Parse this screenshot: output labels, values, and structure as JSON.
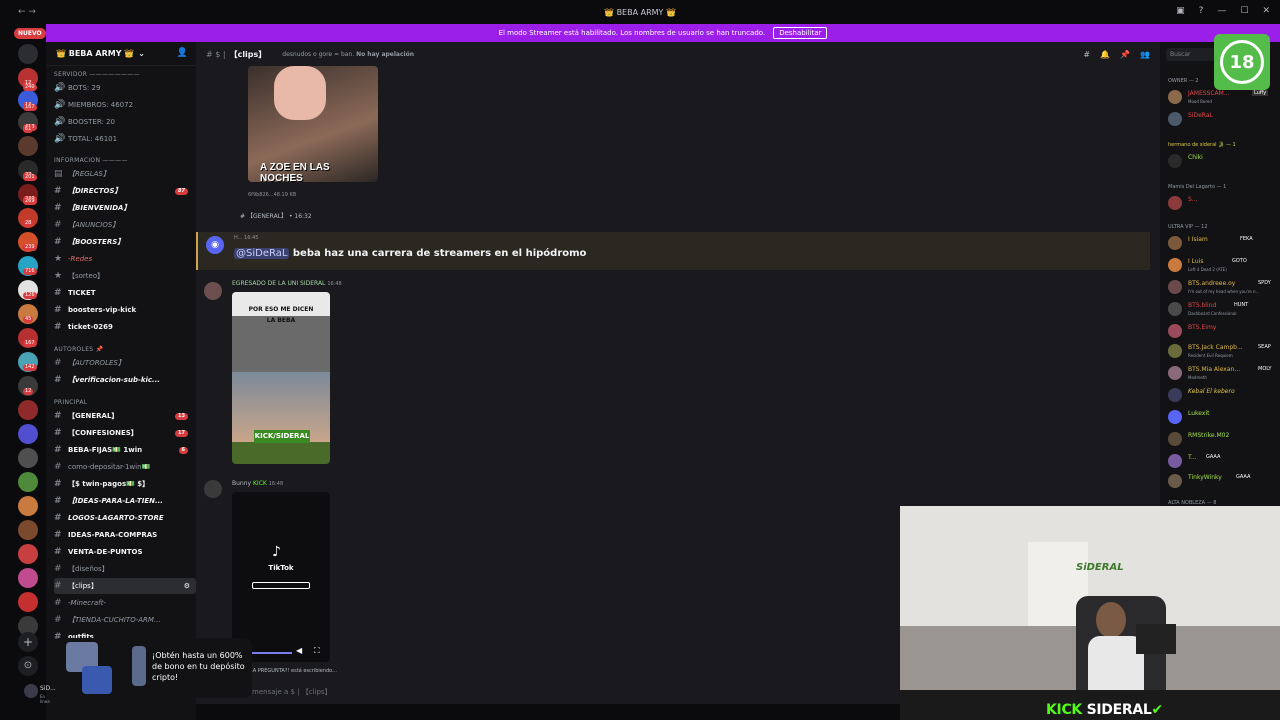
{
  "window": {
    "title": "👑 BEBA ARMY 👑"
  },
  "banner": {
    "text": "El modo Streamer está habilitado. Los nombres de usuario se han truncado.",
    "button": "Deshabilitar"
  },
  "rail": {
    "new_label": "NUEVO",
    "counts": [
      "12",
      "14",
      "413",
      "27",
      "240",
      "167",
      "61",
      "201",
      "269",
      "28",
      "239",
      "716",
      "126",
      "45",
      "167",
      "142",
      "12"
    ]
  },
  "server": {
    "name": "👑 BEBA ARMY 👑"
  },
  "channels": {
    "cat_servidor": "SERVIDOR ————————",
    "bots": "BOTS: 29",
    "miembros": "MIEMBROS: 46072",
    "booster": "BOOSTER: 20",
    "total": "TOTAL: 46101",
    "cat_informacion": "INFORMACION ————",
    "reglas": "【REGLAS】",
    "directos": "【DIRECTOS】",
    "directos_badge": "87",
    "bienvenida": "【BIENVENIDA】",
    "anuncios": "【ANUNCIOS】",
    "boosters": "【BOOSTERS】",
    "redes": "-Redes",
    "sorteo": "【sorteo】",
    "ticket": "TICKET",
    "boosters_vip": "boosters-vip-kick",
    "ticket_0269": "ticket-0269",
    "cat_autoroles": "AUTOROLES 📌",
    "autoroles": "【AUTOROLES】",
    "verificacion": "【verificacion-sub-kic...",
    "cat_principal": "PRINCIPAL",
    "general": "【GENERAL】",
    "general_badge": "13",
    "confesiones": "【CONFESIONES】",
    "confesiones_badge": "17",
    "beba_fijas": "BEBA-FIJAS💵 1win",
    "beba_fijas_badge": "6",
    "como_depositar": "como-depositar-1win💵",
    "twin_pagos": "【$ twin-pagos💵 $】",
    "ideas_tienda": "【IDEAS-PARA-LA-TIEN...",
    "logos": "LOGOS-LAGARTO-STORE",
    "ideas_compras": "IDEAS-PARA-COMPRAS",
    "venta_puntos": "VENTA-DE-PUNTOS",
    "disenos": "【diseños】",
    "clips": "【clips】",
    "minecraft": "-Minecraft-",
    "tienda": "【TIENDA-CUCHITO-ARM...",
    "outfits": "outfits"
  },
  "header": {
    "channel": "【clips】",
    "topic_prefix": "desnudos o gore = ban. ",
    "topic_bold": "No hay apelación"
  },
  "messages": {
    "img1_caption": "A ZOE EN LAS NOCHES",
    "img1_meta": "6f9b826...48.19 KB",
    "reply_ref": "【GENERAL】 • 16:32",
    "m1_author": "H...",
    "m1_time": "16:45",
    "m1_mention": "@SiDeRaL",
    "m1_text": " beba haz una carrera de streamers en el hipódromo",
    "m2_author": "EGRESADO DE LA UNI SIDERAL",
    "m2_time": "16:48",
    "m2_top": "POR ESO ME DICEN",
    "m2_mid": "LA BEBA",
    "m2_kick": "KICK/SIDERAL",
    "m3_author": "Bunny",
    "m3_tag": "KICK",
    "m3_time": "16:48",
    "tiktok": "TikTok"
  },
  "typing": {
    "text": "...A PREGUNTA?! está escribiendo..."
  },
  "input": {
    "placeholder": "mensaje a $ | 【clips】"
  },
  "members": {
    "search": "Buscar",
    "owner_group": "OWNER — 2",
    "owner1_name": "JAMESSCAM...",
    "owner1_status": "Mood Bored",
    "owner1_tag": "Luffy",
    "owner2_name": "SiDeRaL",
    "hermano_group": "hermano de sideral 🐊 — 1",
    "hermano_name": "Chiki",
    "mamis_group": "Mamis Del Lagarto — 1",
    "mamis_name": "S...",
    "ultra_group": "ULTRA VIP — 12",
    "u1_name": "I Isiam",
    "u1_tag": "FEKA",
    "u2_name": "I Luis",
    "u2_tag": "GOTO",
    "u2_status": "Left 4 Dead 2 (ATE)",
    "u3_name": "BTS.andreee.oy",
    "u3_tag": "SPDY",
    "u3_status": "I'm out of my head when you're n...",
    "u4_name": "BTS.blind",
    "u4_tag": "HUNT",
    "u4_status": "Dashboard Confessional",
    "u5_name": "BTS.Eimy",
    "u6_name": "BTS.Jack Campb...",
    "u6_tag": "SEAP",
    "u6_status": "Resident Evil Requiem",
    "u7_name": "BTS.Mia Alexan...",
    "u7_tag": "MOLY",
    "u7_status": "Modmeth",
    "u8_name": "Kebal El kebero",
    "u9_name": "Lukexit",
    "u10_name": "RMStrike.M02",
    "u11_name": "T...",
    "u11_tag": "GAAA",
    "u12_name": "TinkyWinky",
    "u12_tag": "GAAA",
    "nobleza_group": "ALTA NOBLEZA — 8"
  },
  "age_badge": "18",
  "promo": {
    "text": "¡Obtén hasta un 600% de bono en tu depósito cripto!"
  },
  "user": {
    "name": "SiD...",
    "status": "En línea"
  },
  "stream": {
    "logo_kick": "KICK",
    "logo_name": "SIDERAL"
  }
}
